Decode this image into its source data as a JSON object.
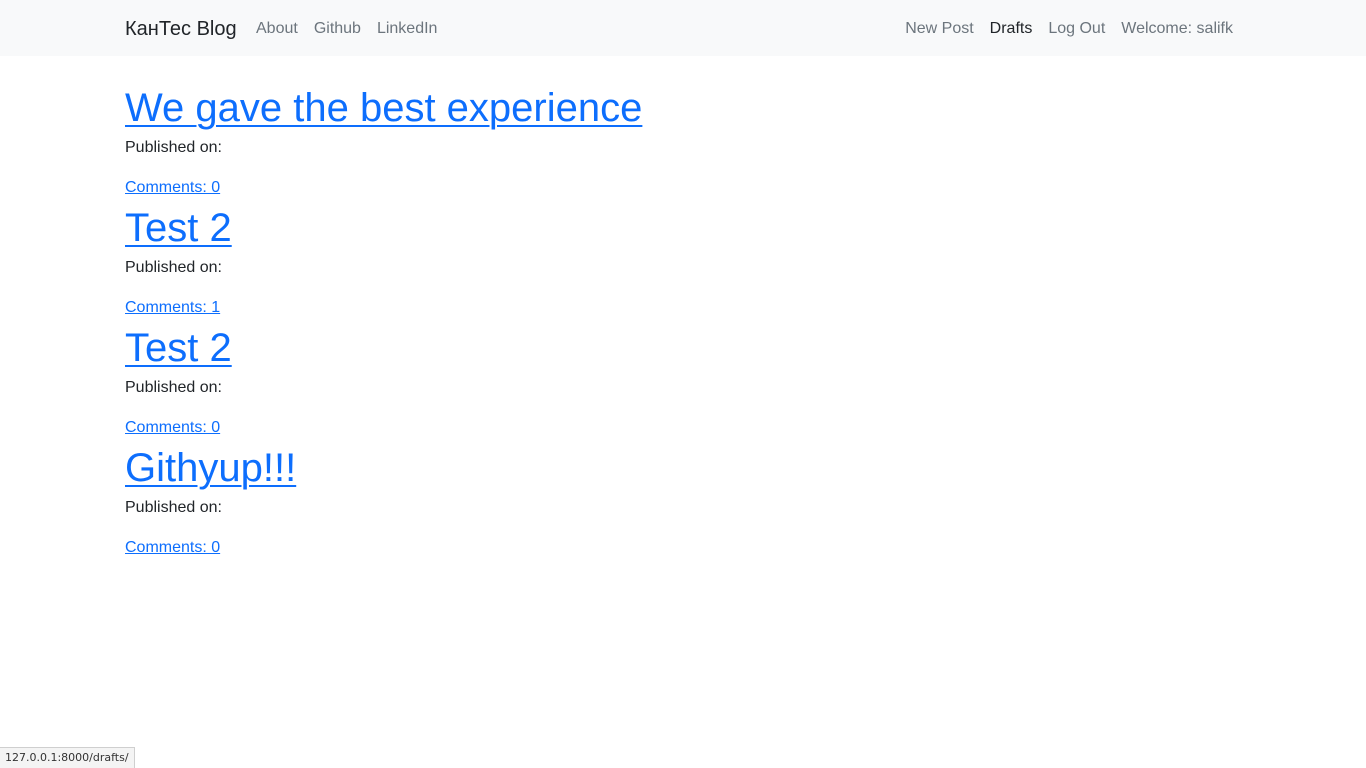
{
  "navbar": {
    "brand": "КанТес Blog",
    "left_links": [
      "About",
      "Github",
      "LinkedIn"
    ],
    "right_links": [
      "New Post",
      "Drafts",
      "Log Out"
    ],
    "welcome": "Welcome: salifk"
  },
  "posts": [
    {
      "title": "We gave the best experience",
      "published": "Published on:",
      "comments": "Comments: 0"
    },
    {
      "title": "Test 2",
      "published": "Published on:",
      "comments": "Comments: 1"
    },
    {
      "title": "Test 2",
      "published": "Published on:",
      "comments": "Comments: 0"
    },
    {
      "title": "Githyup!!!",
      "published": "Published on:",
      "comments": "Comments: 0"
    }
  ],
  "statusbar": {
    "url": "127.0.0.1:8000/drafts/"
  },
  "colors": {
    "link": "#0d6efd",
    "navbar_bg": "#f8f9fa",
    "muted": "#6c757d"
  }
}
